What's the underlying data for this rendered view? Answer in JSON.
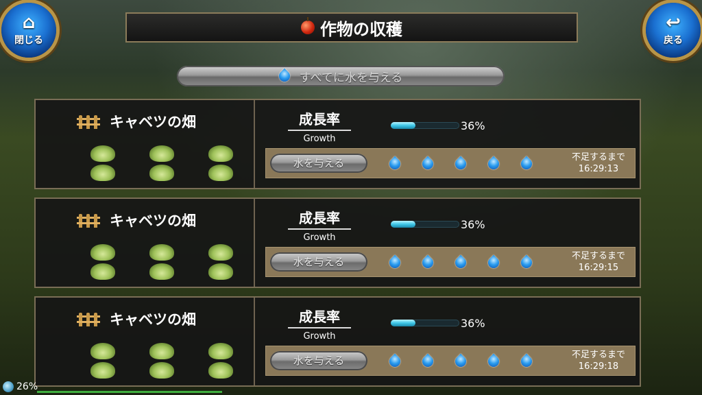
{
  "nav": {
    "close_label": "閉じる",
    "close_icon": "home-icon",
    "back_label": "戻る",
    "back_icon": "return-arrow-icon"
  },
  "title": "作物の収穫",
  "water_all_label": "すべてに水を与える",
  "plots": [
    {
      "name": "キャベツの畑",
      "growth_jp": "成長率",
      "growth_en": "Growth",
      "growth_pct": "36%",
      "growth_value": 0.36,
      "water_button": "水を与える",
      "drops": 5,
      "until_label": "不足するまで",
      "until_time": "16:29:13"
    },
    {
      "name": "キャベツの畑",
      "growth_jp": "成長率",
      "growth_en": "Growth",
      "growth_pct": "36%",
      "growth_value": 0.36,
      "water_button": "水を与える",
      "drops": 5,
      "until_label": "不足するまで",
      "until_time": "16:29:15"
    },
    {
      "name": "キャベツの畑",
      "growth_jp": "成長率",
      "growth_en": "Growth",
      "growth_pct": "36%",
      "growth_value": 0.36,
      "water_button": "水を与える",
      "drops": 5,
      "until_label": "不足するまで",
      "until_time": "16:29:18"
    }
  ],
  "status": {
    "percent": "26%"
  },
  "colors": {
    "accent_blue": "#1a6fd0",
    "gold_frame": "#b89548",
    "bar_cyan": "#3fc8e8",
    "panel_bg": "#161616",
    "water_row_bg": "#8a7858"
  }
}
